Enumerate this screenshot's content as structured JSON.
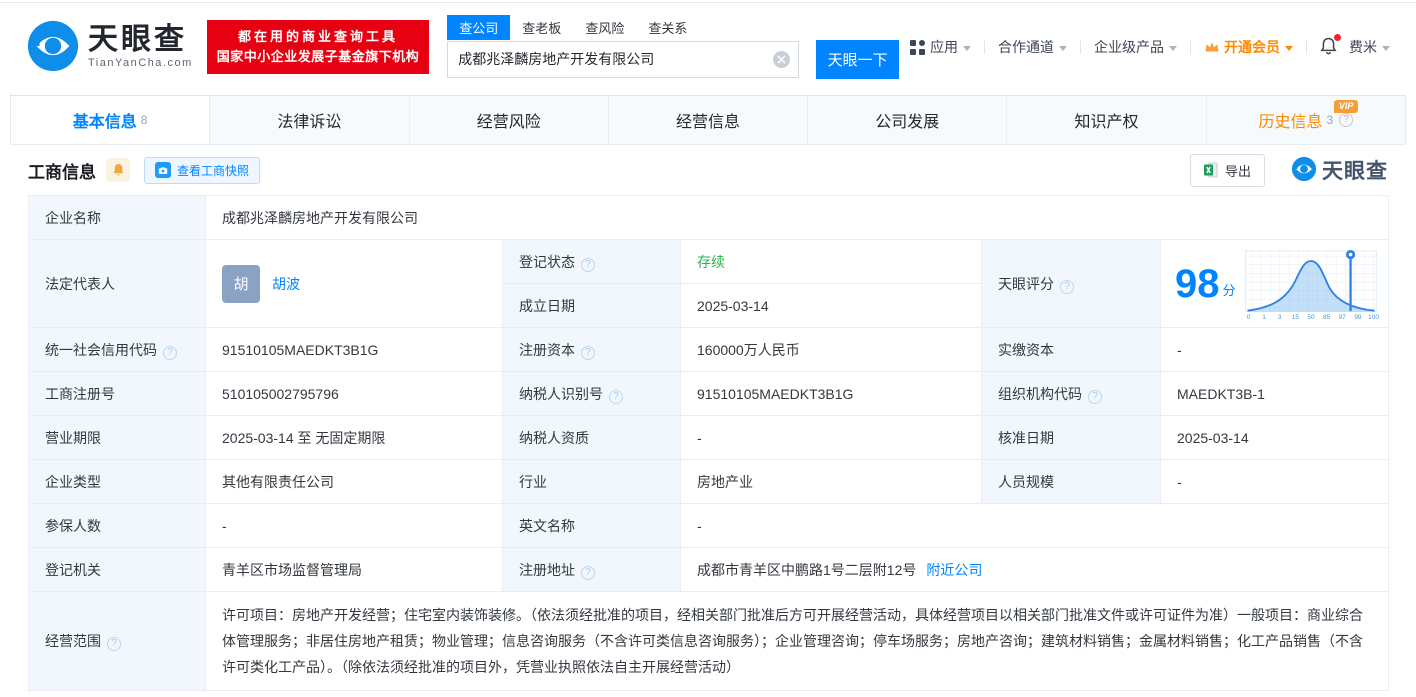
{
  "brand": {
    "name": "天眼查",
    "domain": "TianYanCha.com",
    "slogan1": "都在用的商业查询工具",
    "slogan2": "国家中小企业发展子基金旗下机构"
  },
  "search": {
    "tabs": [
      "查公司",
      "查老板",
      "查风险",
      "查关系"
    ],
    "value": "成都兆泽麟房地产开发有限公司",
    "button": "天眼一下"
  },
  "nav": {
    "apps": "应用",
    "channel": "合作通道",
    "enterprise": "企业级产品",
    "vip": "开通会员",
    "user": "费米"
  },
  "tabs": [
    {
      "label": "基本信息",
      "count": "8"
    },
    {
      "label": "法律诉讼",
      "count": ""
    },
    {
      "label": "经营风险",
      "count": ""
    },
    {
      "label": "经营信息",
      "count": ""
    },
    {
      "label": "公司发展",
      "count": ""
    },
    {
      "label": "知识产权",
      "count": ""
    },
    {
      "label": "历史信息",
      "count": "3",
      "badge": "VIP"
    }
  ],
  "section": {
    "title": "工商信息",
    "snapshot": "查看工商快照",
    "export": "导出",
    "watermark": "天眼查"
  },
  "icons": {
    "help": "?"
  },
  "info": {
    "company_name_label": "企业名称",
    "company_name": "成都兆泽麟房地产开发有限公司",
    "legal_rep_label": "法定代表人",
    "legal_rep_avatar": "胡",
    "legal_rep": "胡波",
    "reg_status_label": "登记状态",
    "reg_status": "存续",
    "est_date_label": "成立日期",
    "est_date": "2025-03-14",
    "score_label": "天眼评分",
    "score": "98",
    "score_unit": "分",
    "uscc_label": "统一社会信用代码",
    "uscc": "91510105MAEDKT3B1G",
    "reg_capital_label": "注册资本",
    "reg_capital": "160000万人民币",
    "paid_capital_label": "实缴资本",
    "paid_capital": "-",
    "reg_no_label": "工商注册号",
    "reg_no": "510105002795796",
    "taxpayer_id_label": "纳税人识别号",
    "taxpayer_id": "91510105MAEDKT3B1G",
    "org_code_label": "组织机构代码",
    "org_code": "MAEDKT3B-1",
    "term_label": "营业期限",
    "term": "2025-03-14 至 无固定期限",
    "taxpayer_qual_label": "纳税人资质",
    "taxpayer_qual": "-",
    "approval_date_label": "核准日期",
    "approval_date": "2025-03-14",
    "company_type_label": "企业类型",
    "company_type": "其他有限责任公司",
    "industry_label": "行业",
    "industry": "房地产业",
    "staff_label": "人员规模",
    "staff": "-",
    "insured_label": "参保人数",
    "insured": "-",
    "en_name_label": "英文名称",
    "en_name": "-",
    "authority_label": "登记机关",
    "authority": "青羊区市场监督管理局",
    "address_label": "注册地址",
    "address": "成都市青羊区中鹏路1号二层附12号",
    "nearby": "附近公司",
    "scope_label": "经营范围",
    "scope": "许可项目：房地产开发经营；住宅室内装饰装修。（依法须经批准的项目，经相关部门批准后方可开展经营活动，具体经营项目以相关部门批准文件或许可证件为准）一般项目：商业综合体管理服务；非居住房地产租赁；物业管理；信息咨询服务（不含许可类信息咨询服务）；企业管理咨询；停车场服务；房地产咨询；建筑材料销售；金属材料销售；化工产品销售（不含许可类化工产品）。（除依法须经批准的项目外，凭营业执照依法自主开展经营活动）"
  },
  "score_chart": {
    "type": "area",
    "ticks": [
      "0",
      "1",
      "3",
      "15",
      "50",
      "85",
      "97",
      "99",
      "100"
    ],
    "marker_value": 98
  },
  "colors": {
    "accent": "#0084ff",
    "vip_orange": "#ff8a00",
    "status_green": "#2db24c",
    "brand_red": "#e60012"
  }
}
